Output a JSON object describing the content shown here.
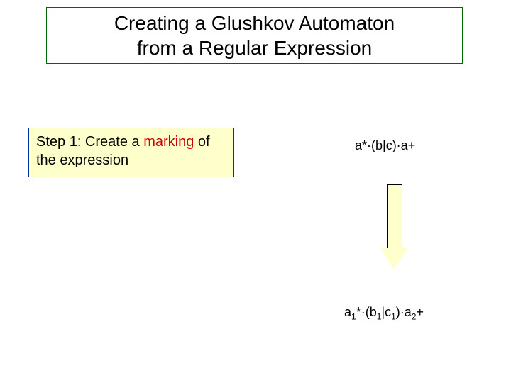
{
  "title": {
    "line1": "Creating a Glushkov Automaton",
    "line2": "from a Regular Expression"
  },
  "step": {
    "prefix": "Step 1: Create a ",
    "highlight": "marking",
    "suffix": " of the expression"
  },
  "exprTop": {
    "raw": "a*·(b|c)·a+"
  },
  "exprBottom": {
    "p1": "a",
    "s1": "1",
    "p2": "*·(b",
    "s2": "1",
    "p3": "|c",
    "s3": "1",
    "p4": ")·a",
    "s4": "2",
    "p5": "+"
  }
}
